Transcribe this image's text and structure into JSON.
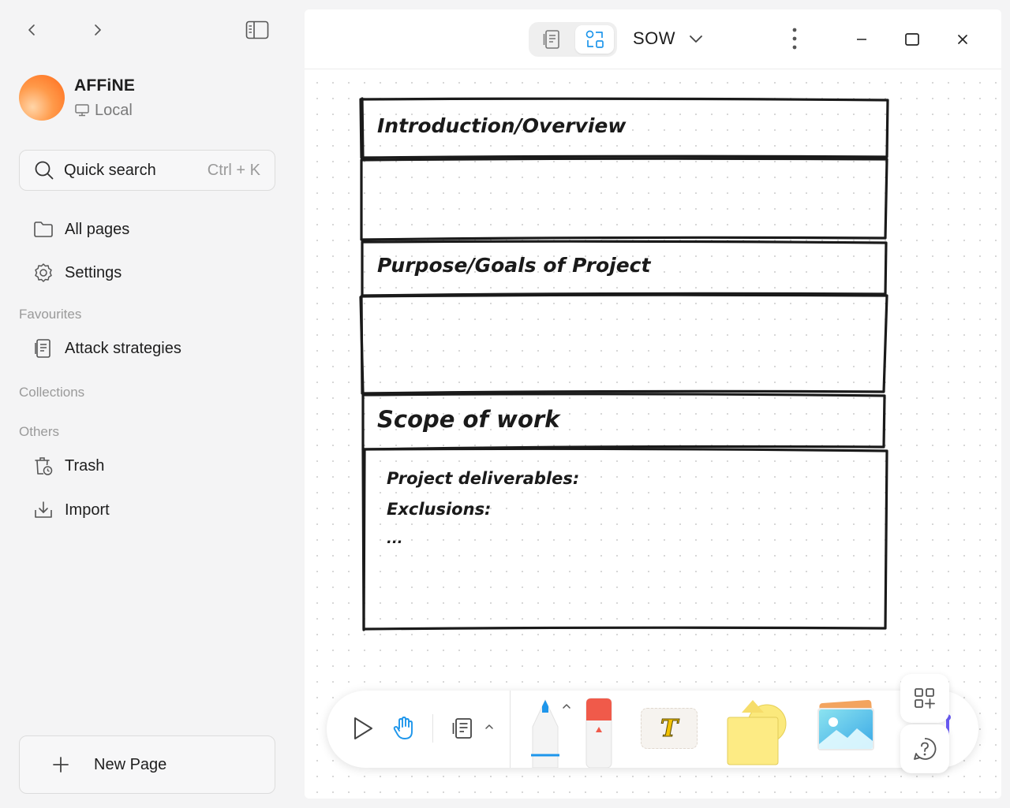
{
  "sidebar": {
    "workspace": {
      "name": "AFFiNE",
      "storage": "Local"
    },
    "search": {
      "label": "Quick search",
      "shortcut": "Ctrl + K"
    },
    "items": [
      {
        "label": "All pages"
      },
      {
        "label": "Settings"
      }
    ],
    "sections": {
      "favourites": "Favourites",
      "collections": "Collections",
      "others": "Others"
    },
    "favourites": [
      {
        "label": "Attack strategies"
      }
    ],
    "others": [
      {
        "label": "Trash"
      },
      {
        "label": "Import"
      }
    ],
    "new_page": "New Page"
  },
  "header": {
    "title": "SOW",
    "mode": "edgeless"
  },
  "canvas": {
    "frames": [
      {
        "heading": "Introduction/Overview"
      },
      {
        "heading": "Purpose/Goals of Project"
      },
      {
        "heading": "Scope of work"
      }
    ],
    "scope_body": {
      "line1": "Project deliverables:",
      "line2": "Exclusions:",
      "line3": "..."
    }
  },
  "toolbar": {
    "text_tool_glyph": "T"
  },
  "colors": {
    "accent": "#1e96eb",
    "sticky": "#fbe97c",
    "eraser": "#f05a4a"
  }
}
